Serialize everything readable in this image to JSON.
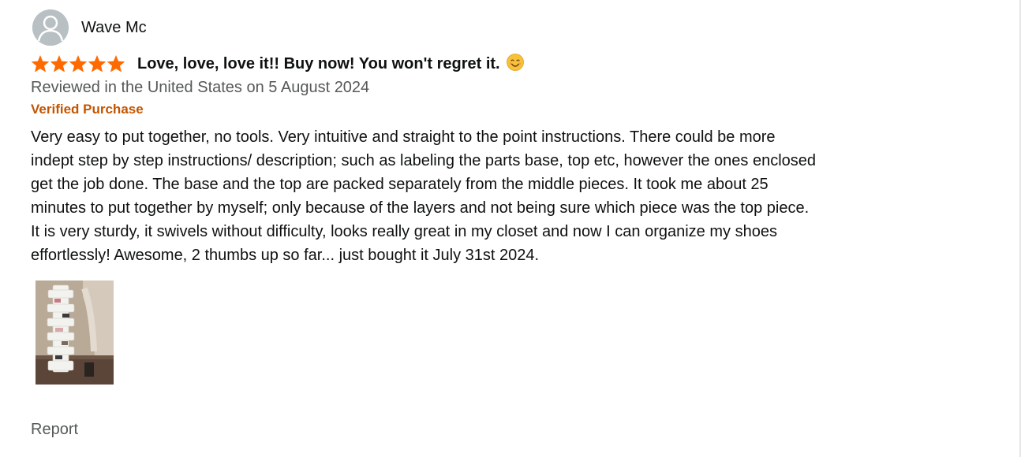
{
  "review": {
    "reviewer_name": "Wave Mc",
    "rating": 5,
    "rating_max": 5,
    "title": "Love, love, love it!! Buy now! You won't regret it.",
    "emoji": "smiling-face-with-smiling-eyes",
    "date_text": "Reviewed in the United States on 5 August 2024",
    "verified_label": "Verified Purchase",
    "body": "Very easy to put together, no tools. Very intuitive and straight to the point instructions. There could be more indept step by step instructions/ description; such as labeling the parts base, top etc, however the ones enclosed get the job done. The base and the top are packed separately from the middle pieces. It took me about 25 minutes to put together by myself; only because of the layers and not being sure which piece was the top piece. It is very sturdy, it swivels without difficulty, looks really great in my closet and now I can organize my shoes effortlessly! Awesome, 2 thumbs up so far... just bought it July 31st 2024.",
    "report_label": "Report"
  },
  "colors": {
    "star": "#ff6a00",
    "verified": "#c45500",
    "secondary_text": "#565959",
    "avatar_bg": "#b8c0c3"
  }
}
